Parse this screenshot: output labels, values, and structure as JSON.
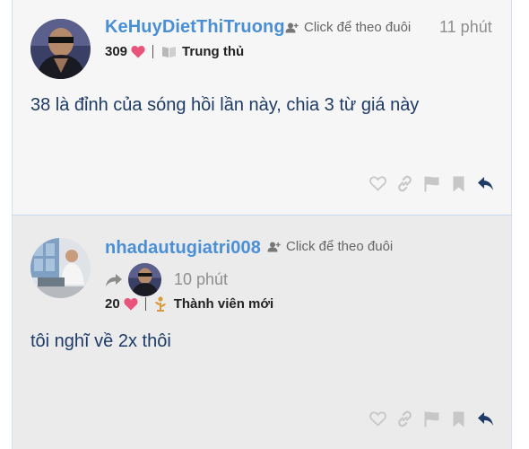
{
  "posts": [
    {
      "username": "KeHuyDietThiTruong",
      "follow_label": "Click để theo đuôi",
      "time": "11 phút",
      "likes": "309",
      "badge": "Trung thủ",
      "body": "38 là đỉnh của sóng hồi lần này, chia 3 từ giá này"
    },
    {
      "username": "nhadautugiatri008",
      "follow_label": "Click để theo đuôi",
      "reply_time": "10 phút",
      "likes": "20",
      "badge": "Thành viên mới",
      "body": "tôi nghĩ về 2x thôi"
    }
  ],
  "icons": {
    "like": "heart-outline-icon",
    "link": "link-icon",
    "flag": "flag-icon",
    "bookmark": "bookmark-icon",
    "reply": "reply-arrow-icon",
    "follow": "person-add-icon"
  },
  "colors": {
    "username": "#4a8fd6",
    "body_text": "#1d3b66",
    "heart": "#e8547a",
    "badge_gold": "#d89a3d",
    "action_gray": "#c7c7c7",
    "reply_blue": "#1d3b66"
  }
}
